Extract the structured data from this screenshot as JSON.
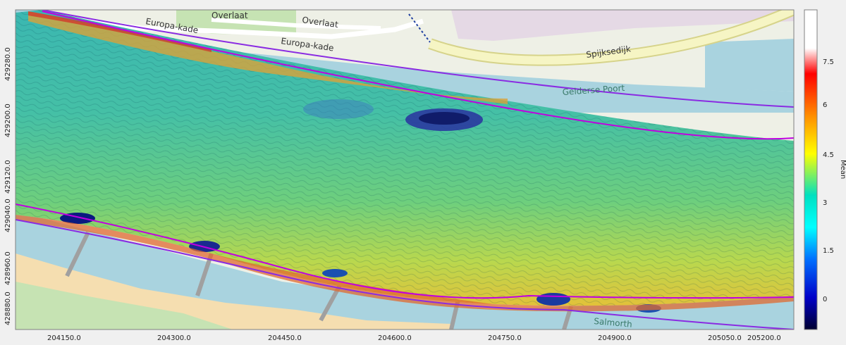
{
  "map": {
    "street_labels": [
      "Overlaat",
      "Overlaat",
      "Europa-kade",
      "Europa-kade",
      "Spijksedijk"
    ],
    "water_labels": [
      "Gelderse Poort",
      "Salmorth"
    ],
    "x_ticks": [
      "204150.0",
      "204300.0",
      "204450.0",
      "204600.0",
      "204750.0",
      "204900.0",
      "205050.0",
      "205200.0"
    ],
    "y_ticks": [
      "429280.0",
      "429200.0",
      "429120.0",
      "429040.0",
      "428960.0",
      "428880.0"
    ]
  },
  "colorbar": {
    "title": "Mean",
    "ticks": [
      "7.5",
      "6",
      "4.5",
      "3",
      "1.5",
      "0"
    ],
    "colors": [
      "#ffffff",
      "#ff0000",
      "#ff8c00",
      "#ffff00",
      "#00ffff",
      "#0070ff",
      "#0000c8",
      "#000030"
    ]
  },
  "colors": {
    "background": "#f0f0f0",
    "water": "#a9d3df",
    "land": "#eef0e6",
    "green": "#c6e3b3",
    "beach": "#f5deb0",
    "road": "#f6f5c4",
    "boundary": "#b800e6"
  }
}
